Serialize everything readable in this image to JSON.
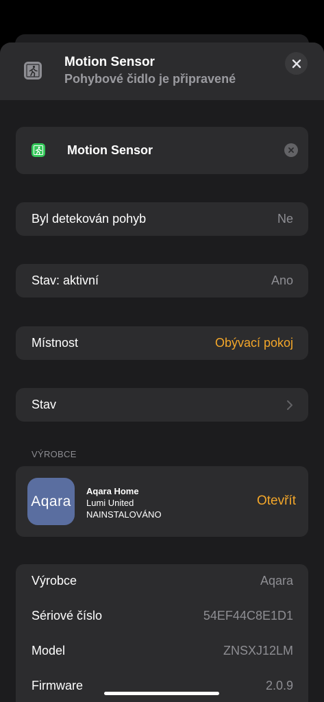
{
  "header": {
    "title": "Motion Sensor",
    "subtitle": "Pohybové čidlo je připravené",
    "icon": "motion-sensor-icon",
    "close_icon": "close-icon"
  },
  "name_field": {
    "value": "Motion Sensor",
    "icon": "motion-sensor-icon",
    "clear_icon": "clear-icon"
  },
  "rows": [
    {
      "label": "Byl detekován pohyb",
      "value": "Ne"
    },
    {
      "label": "Stav: aktivní",
      "value": "Ano"
    },
    {
      "label": "Místnost",
      "value": "Obývací pokoj"
    },
    {
      "label": "Stav",
      "value": ""
    }
  ],
  "manufacturer_section": {
    "label": "VÝROBCE",
    "app": {
      "logo_text": "Aqara",
      "name": "Aqara Home",
      "developer": "Lumi United",
      "status": "NAINSTALOVÁNO",
      "open_label": "Otevřít"
    }
  },
  "info": [
    {
      "label": "Výrobce",
      "value": "Aqara"
    },
    {
      "label": "Sériové číslo",
      "value": "54EF44C8E1D1"
    },
    {
      "label": "Model",
      "value": "ZNSXJ12LM"
    },
    {
      "label": "Firmware",
      "value": "2.0.9"
    }
  ],
  "colors": {
    "accent": "#f4a72a",
    "sheet_bg": "#1c1c1e",
    "card_bg": "#2c2c2e",
    "secondary_text": "#8e8e93",
    "sensor_green": "#34c759"
  }
}
